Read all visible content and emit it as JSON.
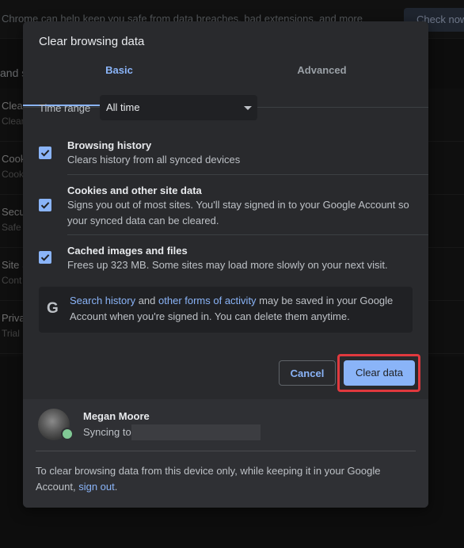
{
  "background": {
    "banner_text": "Chrome can help keep you safe from data breaches, bad extensions, and more",
    "check_button": "Check now",
    "section_fragment": "and s",
    "rows": [
      {
        "title": "Clear",
        "subtitle": "Clear"
      },
      {
        "title": "Cook",
        "subtitle": "Cook"
      },
      {
        "title": "Secu",
        "subtitle": "Safe"
      },
      {
        "title": "Site S",
        "subtitle": "Cont"
      },
      {
        "title": "Priva",
        "subtitle": "Trial"
      }
    ]
  },
  "dialog": {
    "title": "Clear browsing data",
    "tabs": [
      {
        "label": "Basic",
        "active": true
      },
      {
        "label": "Advanced",
        "active": false
      }
    ],
    "time_range": {
      "label": "Time range",
      "value": "All time"
    },
    "options": [
      {
        "title": "Browsing history",
        "description": "Clears history from all synced devices",
        "checked": true
      },
      {
        "title": "Cookies and other site data",
        "description": "Signs you out of most sites. You'll stay signed in to your Google Account so your synced data can be cleared.",
        "checked": true
      },
      {
        "title": "Cached images and files",
        "description": "Frees up 323 MB. Some sites may load more slowly on your next visit.",
        "checked": true
      }
    ],
    "google_notice": {
      "icon": "google-g-icon",
      "link1": "Search history",
      "mid": " and ",
      "link2": "other forms of activity",
      "rest": " may be saved in your Google Account when you're signed in. You can delete them anytime."
    },
    "buttons": {
      "cancel": "Cancel",
      "clear": "Clear data"
    },
    "account": {
      "name": "Megan Moore",
      "sync_label": "Syncing to"
    },
    "footer": {
      "text": "To clear browsing data from this device only, while keeping it in your Google Account, ",
      "link": "sign out",
      "end": "."
    }
  },
  "colors": {
    "accent": "#8ab4f8",
    "dialog_bg": "#292a2d",
    "highlight": "#e0393e"
  }
}
